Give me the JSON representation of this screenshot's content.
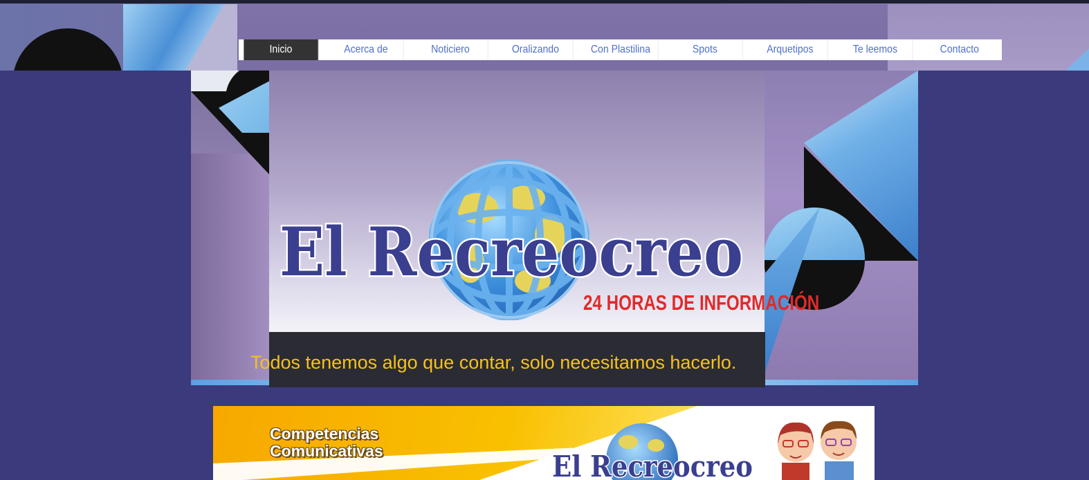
{
  "nav": {
    "items": [
      {
        "label": "Inicio",
        "active": true
      },
      {
        "label": "Acerca de",
        "active": false
      },
      {
        "label": "Noticiero",
        "active": false
      },
      {
        "label": "Oralizando",
        "active": false
      },
      {
        "label": "Con Plastilina",
        "active": false
      },
      {
        "label": "Spots",
        "active": false
      },
      {
        "label": "Arquetipos",
        "active": false
      },
      {
        "label": "Te leemos",
        "active": false
      },
      {
        "label": "Contacto",
        "active": false
      }
    ]
  },
  "hero": {
    "logo_text": "El Recreocreo",
    "slogan": "24 HORAS DE INFORMACIÓN",
    "tagline": "Todos tenemos algo que contar, solo necesitamos hacerlo."
  },
  "banner": {
    "title_line1": "Competencias",
    "title_line2": "Comunicativas",
    "logo_text": "El Recreocreo"
  },
  "colors": {
    "page_bg": "#3a3a7c",
    "nav_text": "#4f6fcd",
    "nav_active_bg": "#333333",
    "tagline": "#f6c21a",
    "slogan": "#e02a2a",
    "logo_text": "#3b3f8f"
  },
  "icons": [
    "globe-logo-icon",
    "kids-illustration-icon"
  ]
}
